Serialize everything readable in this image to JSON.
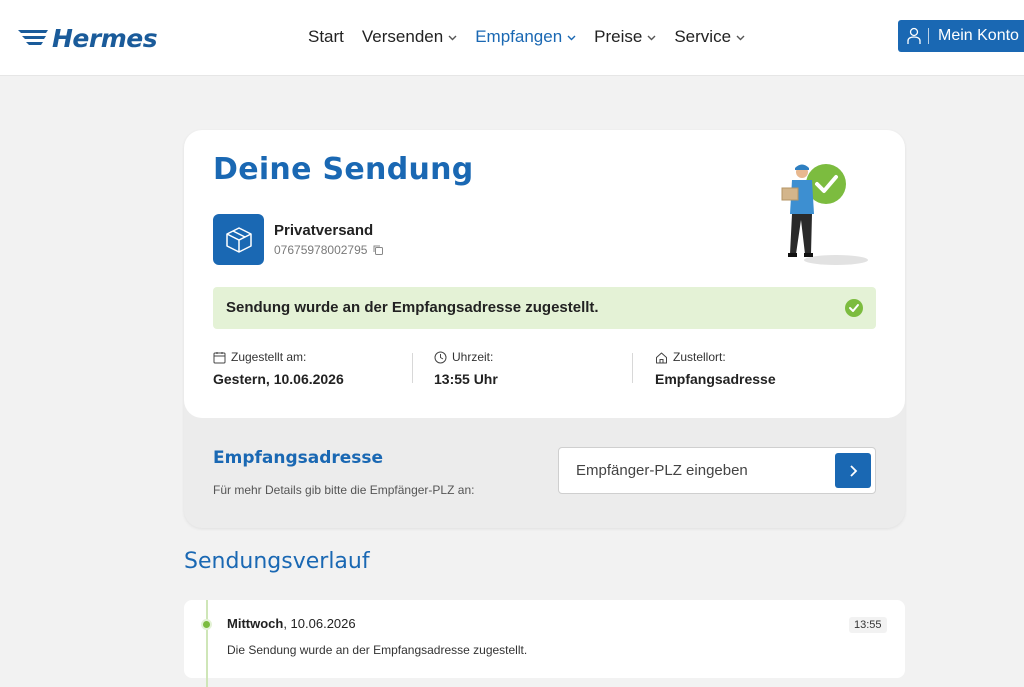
{
  "header": {
    "logo_text": "Hermes",
    "nav": [
      {
        "label": "Start",
        "has_dropdown": false
      },
      {
        "label": "Versenden",
        "has_dropdown": true
      },
      {
        "label": "Empfangen",
        "has_dropdown": true,
        "active": true
      },
      {
        "label": "Preise",
        "has_dropdown": true
      },
      {
        "label": "Service",
        "has_dropdown": true
      }
    ],
    "account_label": "Mein Konto"
  },
  "shipment": {
    "title": "Deine Sendung",
    "type": "Privatversand",
    "number": "07675978002795",
    "status": "Sendung wurde an der Empfangsadresse zugestellt.",
    "delivered_label": "Zugestellt am:",
    "delivered_value": "Gestern, 10.06.2026",
    "time_label": "Uhrzeit:",
    "time_value": "13:55 Uhr",
    "place_label": "Zustellort:",
    "place_value": "Empfangsadresse"
  },
  "address": {
    "title": "Empfangsadresse",
    "hint": "Für mehr Details gib bitte die Empfänger-PLZ an:",
    "plz_placeholder": "Empfänger-PLZ eingeben",
    "plz_value": ""
  },
  "history": {
    "title": "Sendungsverlauf",
    "events": [
      {
        "day": "Mittwoch",
        "date": ", 10.06.2026",
        "text": "Die Sendung wurde an der Empfangsadresse zugestellt.",
        "time": "13:55"
      }
    ]
  },
  "colors": {
    "brand_blue": "#1a68b3",
    "status_green_bg": "#e4f2d6",
    "status_green": "#7cbc3f"
  },
  "icons": {
    "package": "box-icon",
    "copy": "copy-icon",
    "calendar": "calendar-icon",
    "clock": "clock-icon",
    "home": "home-icon",
    "user": "user-icon",
    "chevron": "chevron-down-icon",
    "submit": "chevron-right-icon",
    "check": "check-circle-icon"
  }
}
